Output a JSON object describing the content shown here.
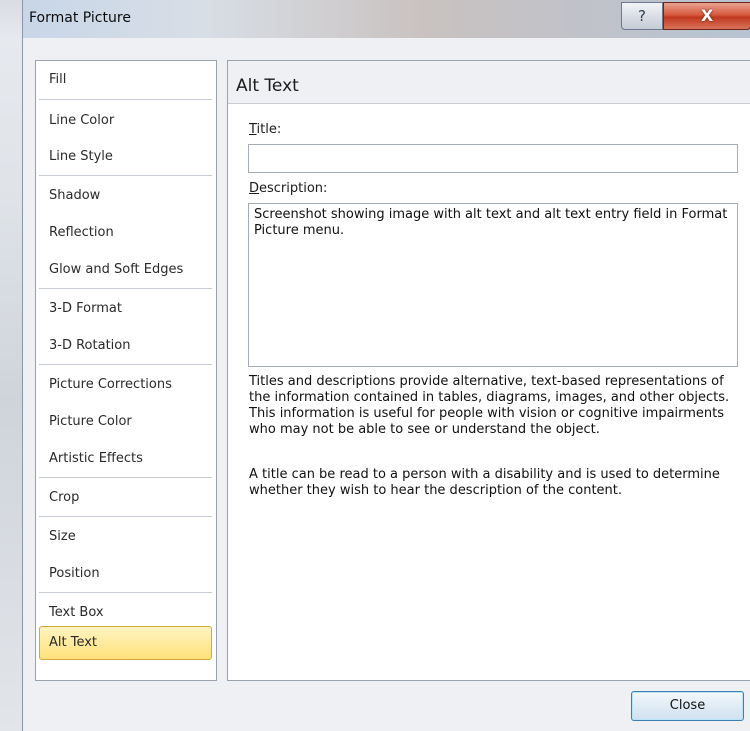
{
  "window": {
    "title": "Format Picture",
    "help_glyph": "?",
    "close_glyph": "X"
  },
  "sidebar": {
    "items": [
      {
        "label": "Fill"
      },
      {
        "label": "Line Color"
      },
      {
        "label": "Line Style"
      },
      {
        "label": "Shadow"
      },
      {
        "label": "Reflection"
      },
      {
        "label": "Glow and Soft Edges"
      },
      {
        "label": "3-D Format"
      },
      {
        "label": "3-D Rotation"
      },
      {
        "label": "Picture Corrections"
      },
      {
        "label": "Picture Color"
      },
      {
        "label": "Artistic Effects"
      },
      {
        "label": "Crop"
      },
      {
        "label": "Size"
      },
      {
        "label": "Position"
      },
      {
        "label": "Text Box"
      },
      {
        "label": "Alt Text",
        "selected": true
      }
    ]
  },
  "panel": {
    "heading": "Alt Text",
    "title_label_mnemonic": "T",
    "title_label_rest": "itle:",
    "title_value": "",
    "description_label_mnemonic": "D",
    "description_label_rest": "escription:",
    "description_value": "Screenshot showing image with alt text and alt text entry field in Format Picture menu.",
    "help_paragraph_1": "Titles and descriptions provide alternative, text-based representations of the information contained in tables, diagrams, images, and other objects. This information is useful for people with vision or cognitive impairments who may not be able to see or understand the object.",
    "help_paragraph_2": "A title can be read to a person with a disability and is used to determine whether they wish to hear the description of the content."
  },
  "footer": {
    "close_label": "Close"
  },
  "colors": {
    "selected_item_bg": "#ffe27a",
    "selected_item_border": "#d4a83a",
    "close_window_red": "#c0391f",
    "dialog_bg": "#eef0f3"
  }
}
